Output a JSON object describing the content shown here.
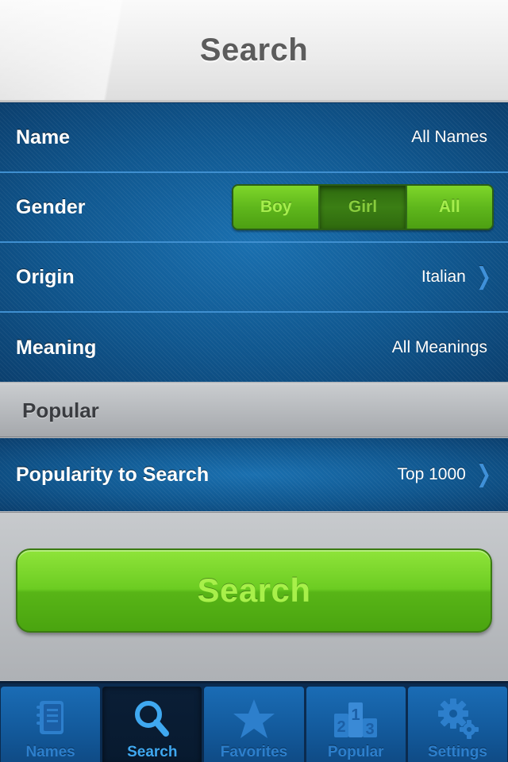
{
  "nav": {
    "title": "Search"
  },
  "rows": [
    {
      "label": "Name",
      "value": "All Names"
    },
    {
      "label": "Gender",
      "options": [
        "Boy",
        "Girl",
        "All"
      ],
      "selected": "Girl"
    },
    {
      "label": "Origin",
      "value": "Italian"
    },
    {
      "label": "Meaning",
      "value": "All Meanings"
    }
  ],
  "popular_section": {
    "header": "Popular",
    "row": {
      "label": "Popularity to Search",
      "value": "Top 1000"
    }
  },
  "search_button": {
    "label": "Search"
  },
  "tabs": [
    {
      "label": "Names",
      "icon": "notebook-icon"
    },
    {
      "label": "Search",
      "icon": "magnifier-icon",
      "active": true
    },
    {
      "label": "Favorites",
      "icon": "star-icon"
    },
    {
      "label": "Popular",
      "icon": "podium-icon",
      "podium_digits": [
        "2",
        "1",
        "3"
      ]
    },
    {
      "label": "Settings",
      "icon": "gears-icon"
    }
  ],
  "colors": {
    "accent_green": "#6ccc22",
    "section_blue": "#0f5a93",
    "tab_inactive_text": "#2d7fcc",
    "tab_active_text": "#3fa8f0"
  }
}
